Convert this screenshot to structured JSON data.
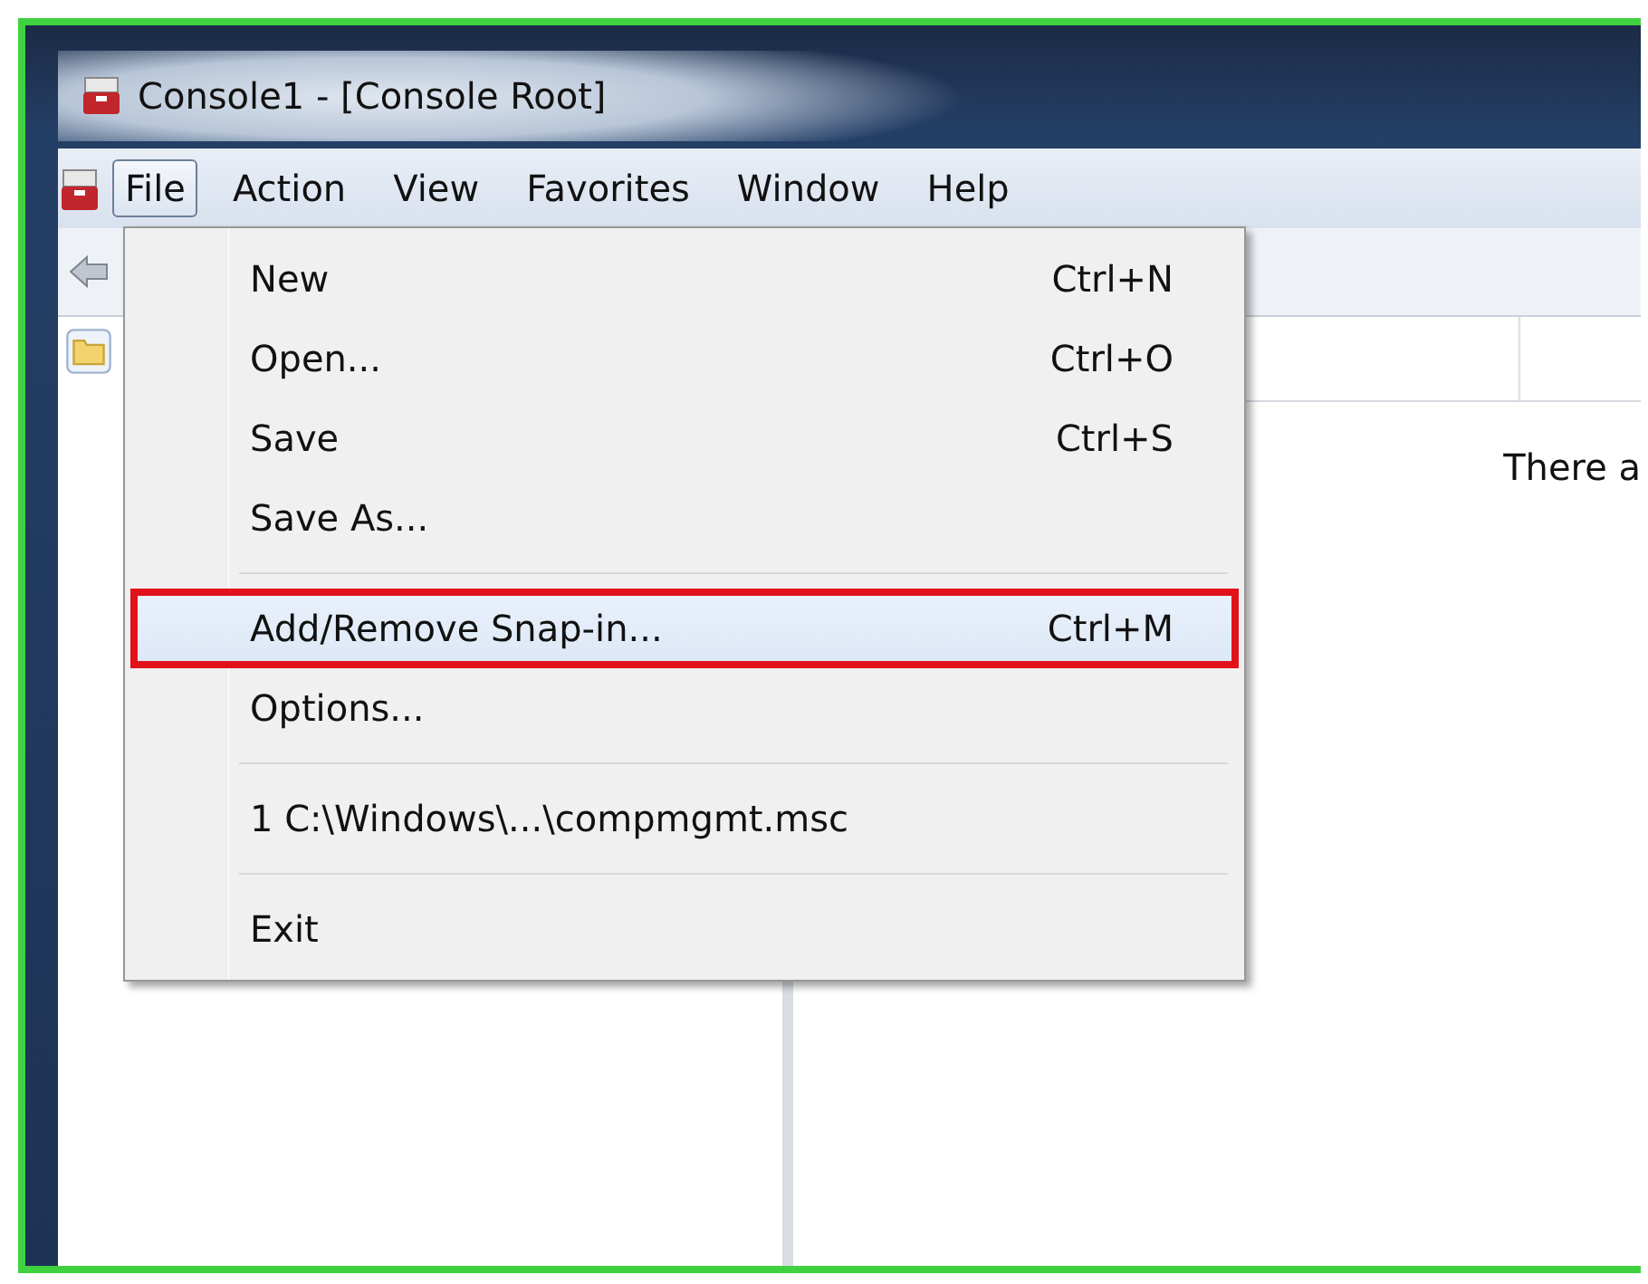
{
  "window": {
    "title": "Console1 - [Console Root]"
  },
  "menu_bar": [
    {
      "label": "File",
      "selected": true
    },
    {
      "label": "Action",
      "selected": false
    },
    {
      "label": "View",
      "selected": false
    },
    {
      "label": "Favorites",
      "selected": false
    },
    {
      "label": "Window",
      "selected": false
    },
    {
      "label": "Help",
      "selected": false
    }
  ],
  "file_menu": {
    "items": [
      {
        "kind": "item",
        "label": "New",
        "shortcut": "Ctrl+N",
        "selected": false,
        "annotated": false
      },
      {
        "kind": "item",
        "label": "Open...",
        "shortcut": "Ctrl+O",
        "selected": false,
        "annotated": false
      },
      {
        "kind": "item",
        "label": "Save",
        "shortcut": "Ctrl+S",
        "selected": false,
        "annotated": false
      },
      {
        "kind": "item",
        "label": "Save As...",
        "selected": false,
        "annotated": false
      },
      {
        "kind": "separator"
      },
      {
        "kind": "item",
        "label": "Add/Remove Snap-in...",
        "shortcut": "Ctrl+M",
        "selected": true,
        "annotated": true
      },
      {
        "kind": "item",
        "label": "Options...",
        "selected": false,
        "annotated": false
      },
      {
        "kind": "separator"
      },
      {
        "kind": "item",
        "label": "1 C:\\Windows\\...\\compmgmt.msc",
        "selected": false,
        "annotated": false
      },
      {
        "kind": "separator"
      },
      {
        "kind": "item",
        "label": "Exit",
        "selected": false,
        "annotated": false
      }
    ]
  },
  "results_pane": {
    "message": "There a"
  }
}
